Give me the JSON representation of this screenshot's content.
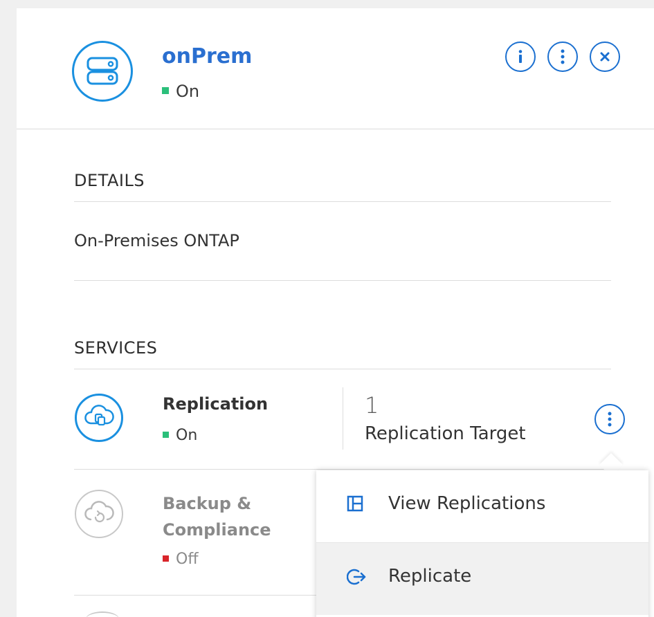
{
  "environment": {
    "name": "onPrem",
    "status": "On",
    "status_color": "#2bbf7a",
    "icon": "storage-server-icon",
    "header_actions": [
      {
        "name": "info",
        "icon": "info-icon"
      },
      {
        "name": "more",
        "icon": "more-vertical-icon"
      },
      {
        "name": "close",
        "icon": "close-icon"
      }
    ]
  },
  "details": {
    "heading": "DETAILS",
    "type": "On-Premises ONTAP"
  },
  "services": {
    "heading": "SERVICES",
    "items": [
      {
        "name": "Replication",
        "status": "On",
        "status_color": "#2bbf7a",
        "icon": "cloud-replication-icon",
        "count": "1",
        "count_label": "Replication Target"
      },
      {
        "name_line1": "Backup &",
        "name_line2": "Compliance",
        "status": "Off",
        "status_color": "#d9252a",
        "icon": "cloud-backup-icon"
      }
    ]
  },
  "menu": {
    "items": [
      {
        "label": "View Replications",
        "icon": "view-replications-icon"
      },
      {
        "label": "Replicate",
        "icon": "replicate-icon"
      }
    ]
  },
  "colors": {
    "accent": "#1a6fd0",
    "title": "#2a6fd0",
    "divider": "#dcdcdc"
  }
}
